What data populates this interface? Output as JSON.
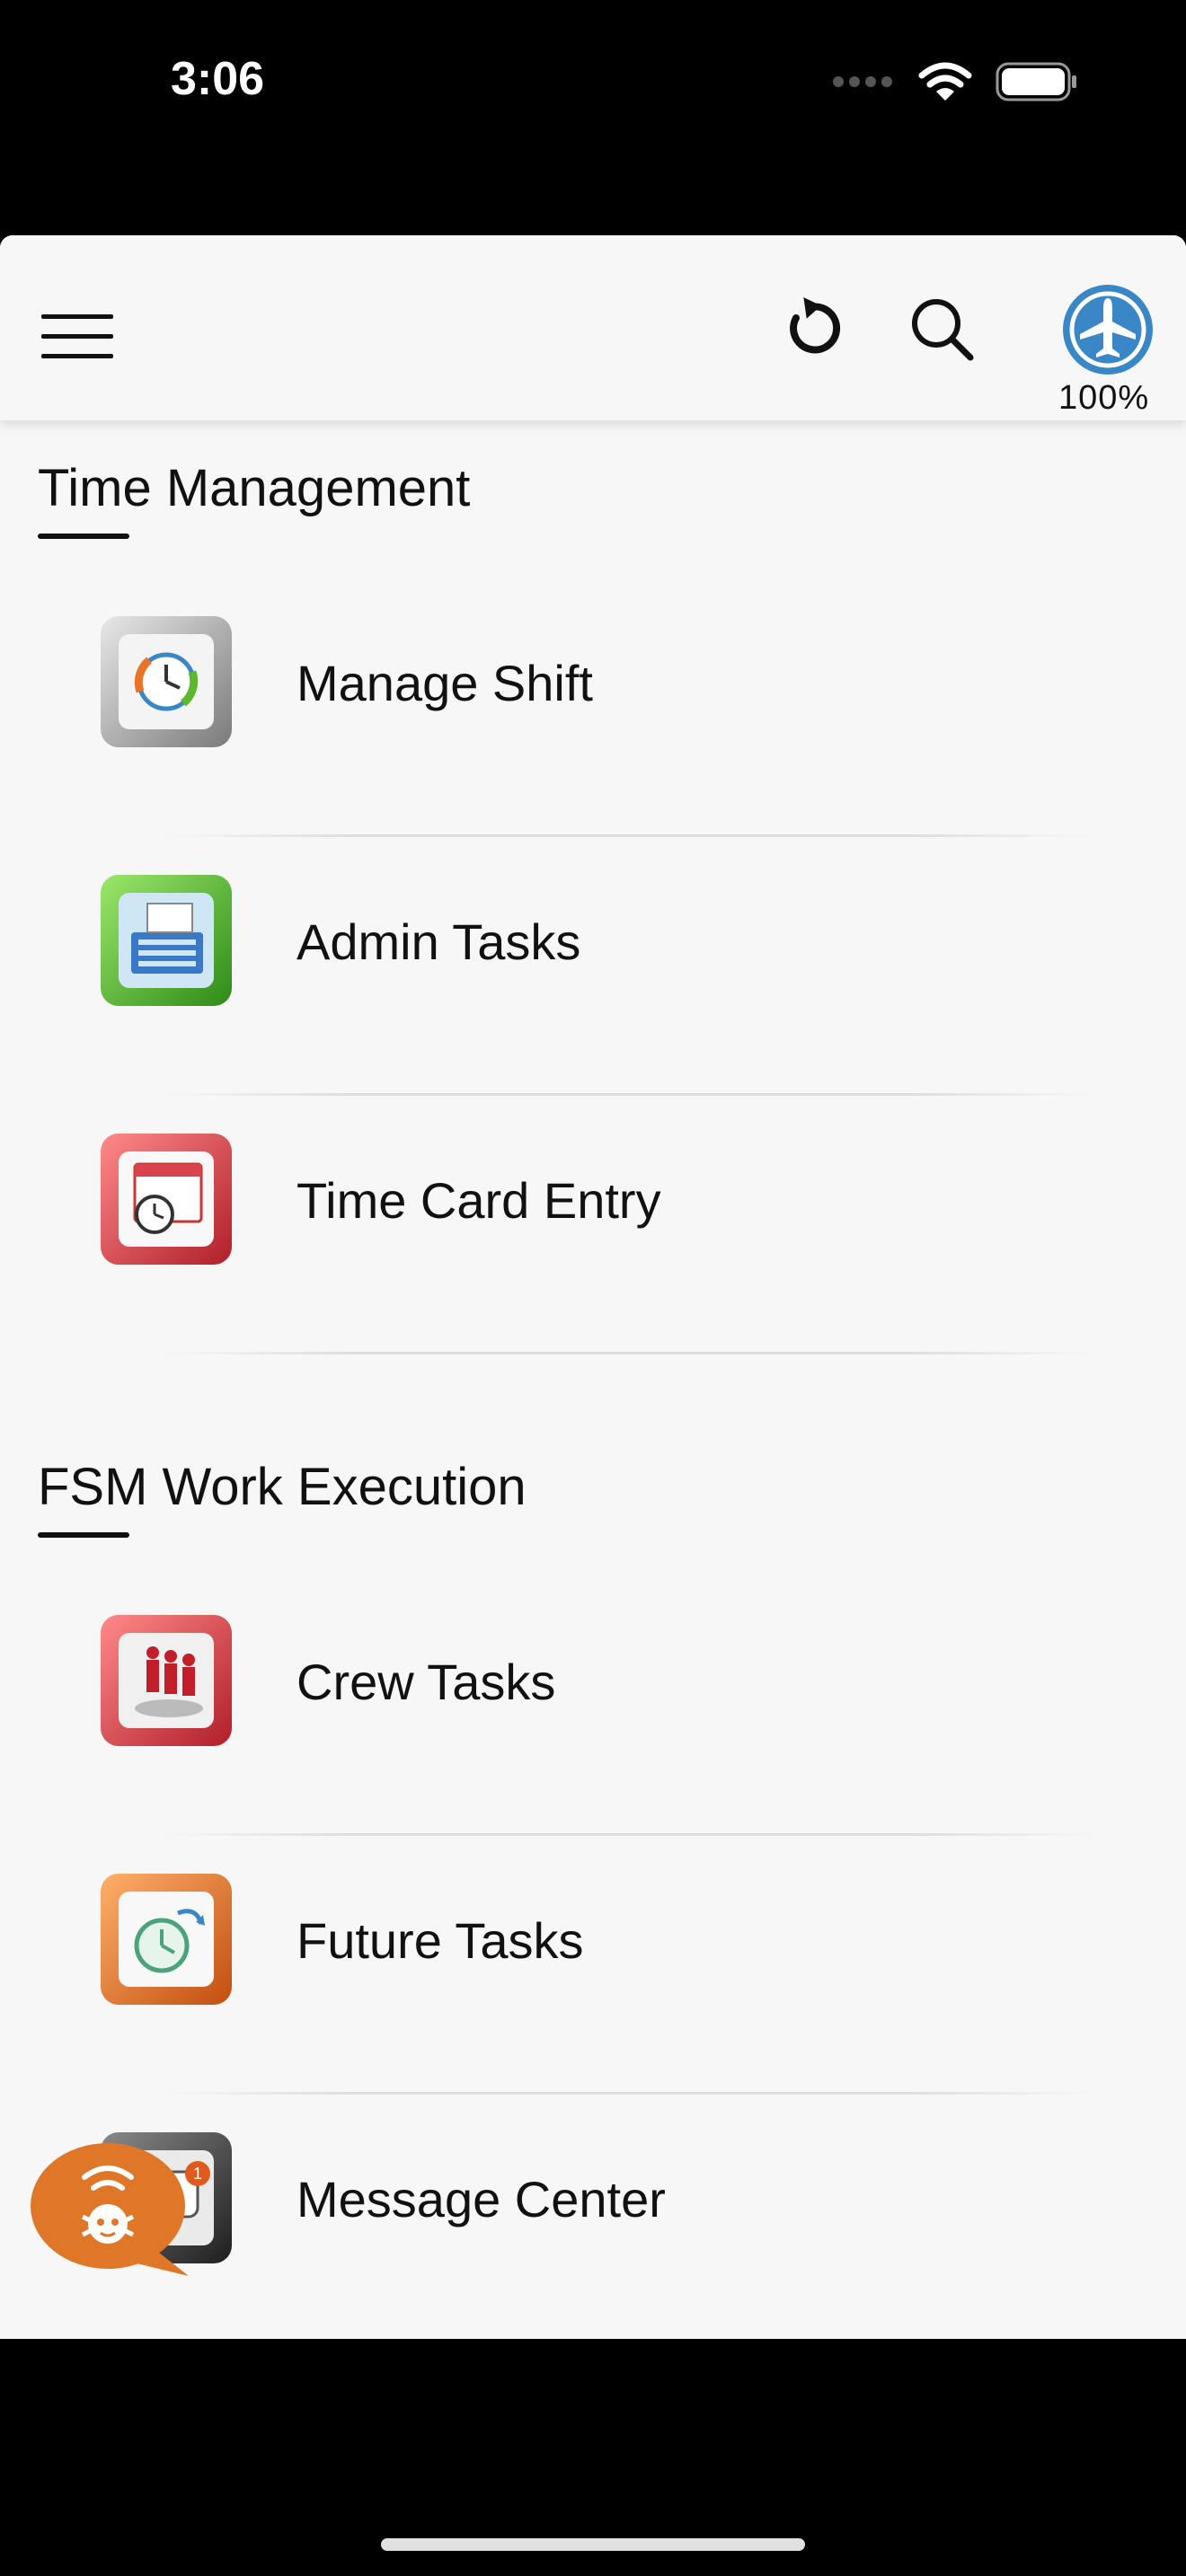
{
  "status_bar": {
    "time": "3:06"
  },
  "toolbar": {
    "connection_percent": "100%"
  },
  "sections": [
    {
      "title": "Time Management",
      "items": [
        {
          "label": "Manage Shift",
          "icon": "manage-shift-icon",
          "color": "#9a9a9a"
        },
        {
          "label": "Admin Tasks",
          "icon": "admin-tasks-icon",
          "color": "#5cb82e"
        },
        {
          "label": "Time Card Entry",
          "icon": "time-card-icon",
          "color": "#d9444c"
        }
      ]
    },
    {
      "title": "FSM Work Execution",
      "items": [
        {
          "label": "Crew Tasks",
          "icon": "crew-tasks-icon",
          "color": "#d9444c"
        },
        {
          "label": "Future Tasks",
          "icon": "future-tasks-icon",
          "color": "#e8742a"
        },
        {
          "label": "Message Center",
          "icon": "message-center-icon",
          "color": "#3a3a3a",
          "badge": "1"
        }
      ]
    }
  ],
  "colors": {
    "accent_blue": "#3a87c8",
    "fab_orange": "#e07728",
    "background": "#f7f7f7"
  }
}
